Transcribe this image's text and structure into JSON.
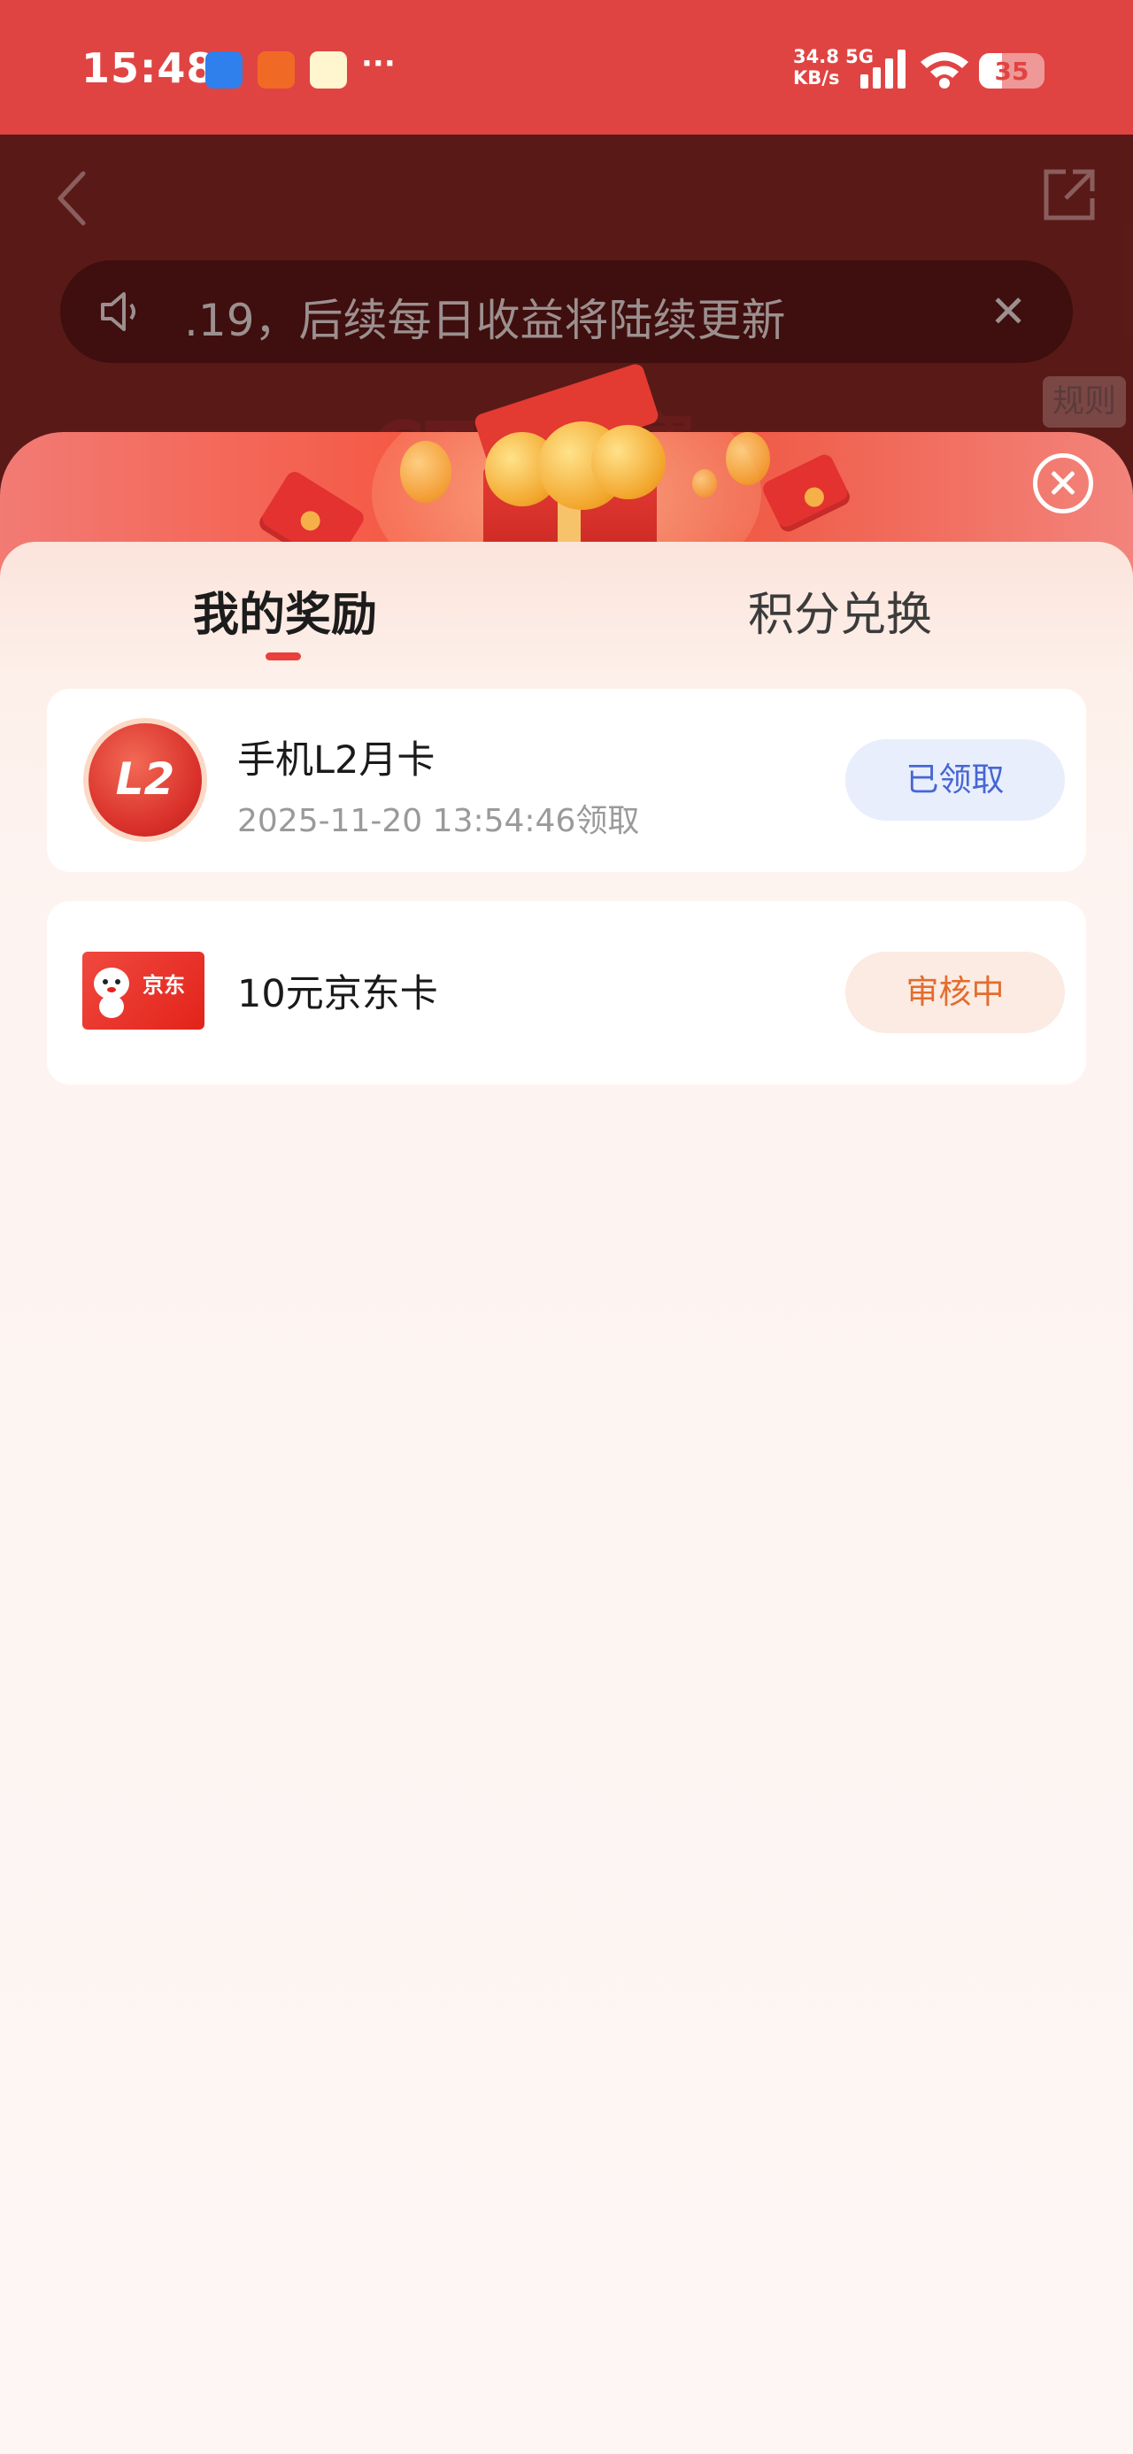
{
  "status_bar": {
    "time": "15:48",
    "network_speed": "34.8",
    "network_unit": "KB/s",
    "network_type": "5G",
    "battery": "35",
    "battery_fraction": 0.35,
    "more_indicator": "···"
  },
  "background_page": {
    "notice_text": ".19，后续每日收益将陆续更新",
    "rules_label": "规则",
    "title_fragment": "CTF  大赛"
  },
  "sheet": {
    "tabs": [
      {
        "label": "我的奖励",
        "active": true
      },
      {
        "label": "积分兑换",
        "active": false
      }
    ],
    "rewards": [
      {
        "badge_text": "L2",
        "title": "手机L2月卡",
        "subtitle": "2025-11-20 13:54:46领取",
        "status": "已领取",
        "status_color": "#4766d4"
      },
      {
        "badge_text": "京东",
        "title": "10元京东卡",
        "subtitle": "",
        "status": "审核中",
        "status_color": "#e26d2f"
      }
    ]
  },
  "colors": {
    "status_bar": "#e04442",
    "accent_red": "#ea3f3b",
    "claimed_blue": "#4766d4",
    "review_orange": "#e26d2f"
  },
  "icons": [
    "back-arrow-icon",
    "share-icon",
    "speaker-icon",
    "close-icon",
    "close-circle-icon",
    "gift-box-icon",
    "l2-badge-icon",
    "jd-card-icon"
  ]
}
